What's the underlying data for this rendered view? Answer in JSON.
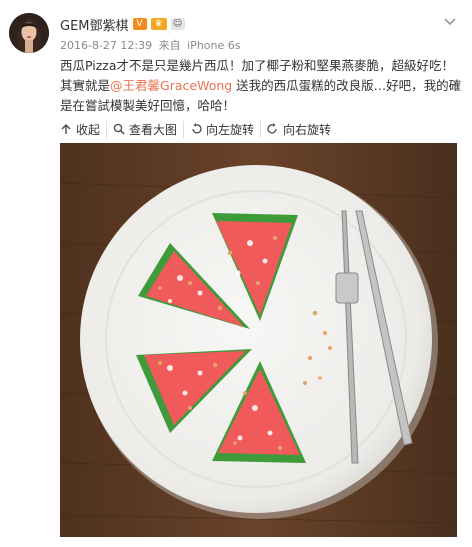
{
  "user": {
    "name": "GEM鄧紫棋",
    "badges": [
      "V",
      "VIP",
      "cow"
    ]
  },
  "meta": {
    "timestamp": "2016-8-27 12:39",
    "source_prefix": "来自",
    "device": "iPhone 6s"
  },
  "post": {
    "text_before": "西瓜Pizza才不是只是幾片西瓜！加了椰子粉和堅果燕麥脆，超級好吃！其實就是",
    "mention": "@王君馨GraceWong",
    "text_after": " 送我的西瓜蛋糕的改良版…好吧，我的確是在嘗試模製美好回憶，哈哈！"
  },
  "actions": [
    {
      "label": "收起",
      "icon": "arrow-up-icon"
    },
    {
      "label": "查看大图",
      "icon": "magnifier-icon"
    },
    {
      "label": "向左旋转",
      "icon": "rotate-left-icon"
    },
    {
      "label": "向右旋转",
      "icon": "rotate-right-icon"
    }
  ],
  "colors": {
    "mention": "#eb7350",
    "meta": "#8a8a8a",
    "wood": "#5a3a24",
    "plate": "#f1f1ef",
    "melon_flesh": "#f05a5a",
    "melon_rind": "#3f9a3a"
  }
}
